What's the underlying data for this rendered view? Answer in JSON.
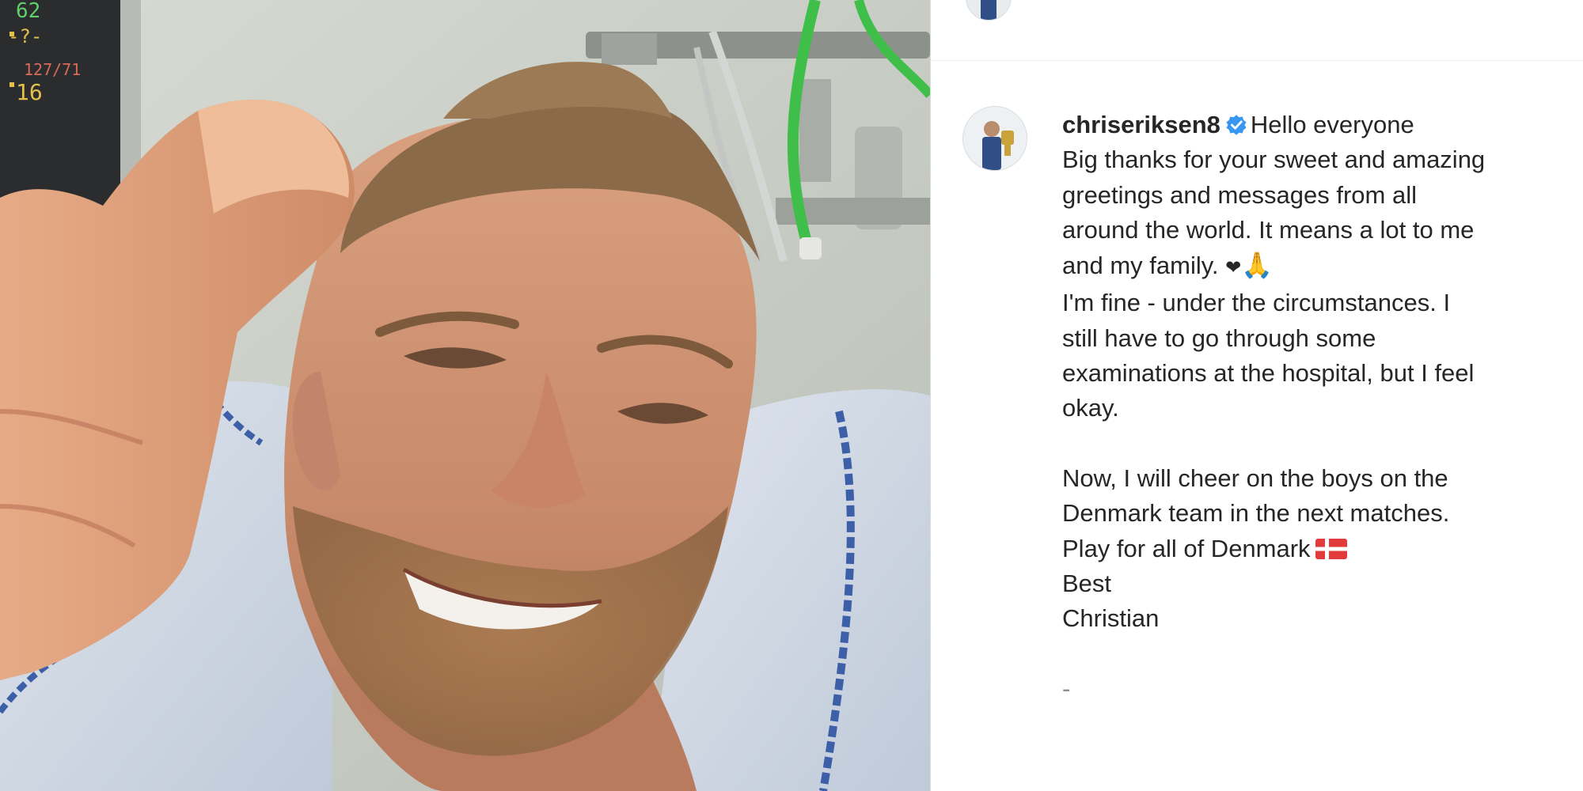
{
  "post": {
    "username": "chriseriksen8",
    "verified": true,
    "caption_lines": [
      "Hello everyone",
      "Big thanks for your sweet and amazing",
      "greetings and messages from all",
      "around the world. It means a lot to me",
      "and my family.",
      "I'm fine - under the circumstances. I",
      "still have to go through some",
      "examinations at the hospital, but I feel",
      "okay.",
      "",
      "Now, I will cheer on the boys on the",
      "Denmark team in the next matches.",
      "Play for all of Denmark",
      "Best",
      "Christian",
      "",
      "-"
    ],
    "heart_emoji": "❤",
    "pray_emoji": "🙏",
    "monitor_readings": [
      "62",
      "-?-",
      "127/71",
      "16"
    ]
  },
  "colors": {
    "verified_blue": "#3897f0",
    "text": "#262626",
    "divider": "#efefef"
  },
  "icons": {
    "verified": "verified-badge-icon",
    "flag": "denmark-flag-icon"
  }
}
